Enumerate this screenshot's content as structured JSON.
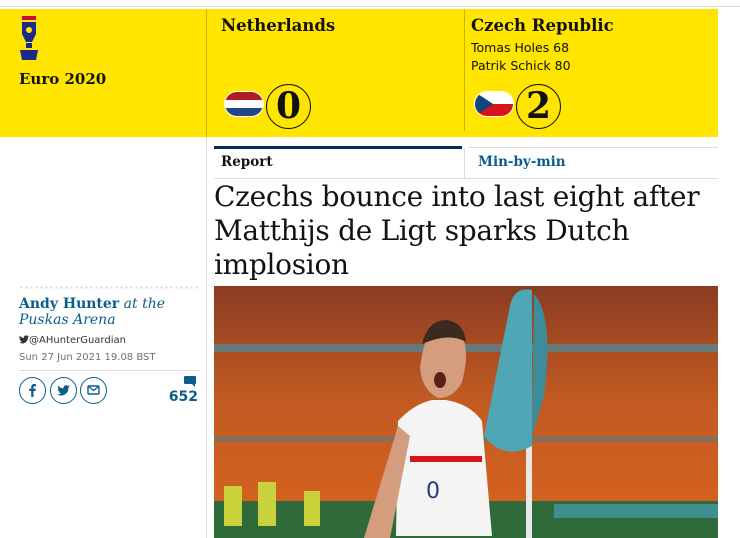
{
  "competition": {
    "name": "Euro 2020"
  },
  "match": {
    "home": {
      "name": "Netherlands",
      "score": "0",
      "scorers": []
    },
    "away": {
      "name": "Czech Republic",
      "score": "2",
      "scorers": [
        "Tomas Holes 68",
        "Patrik Schick 80"
      ]
    }
  },
  "tabs": [
    {
      "label": "Report",
      "active": true
    },
    {
      "label": "Min-by-min",
      "active": false
    }
  ],
  "article": {
    "headline": "Czechs bounce into last eight after Matthijs de Ligt sparks Dutch implosion"
  },
  "byline": {
    "author": "Andy Hunter",
    "location": "at the Puskas Arena",
    "twitter": "@AHunterGuardian",
    "date": "Sun 27 Jun 2021 19.08 BST"
  },
  "share": {
    "icons": [
      "facebook-icon",
      "twitter-icon",
      "email-icon"
    ]
  },
  "comments": {
    "count": "652"
  },
  "colors": {
    "banner": "#ffe500",
    "link": "#0c5d8c",
    "text": "#121212"
  }
}
